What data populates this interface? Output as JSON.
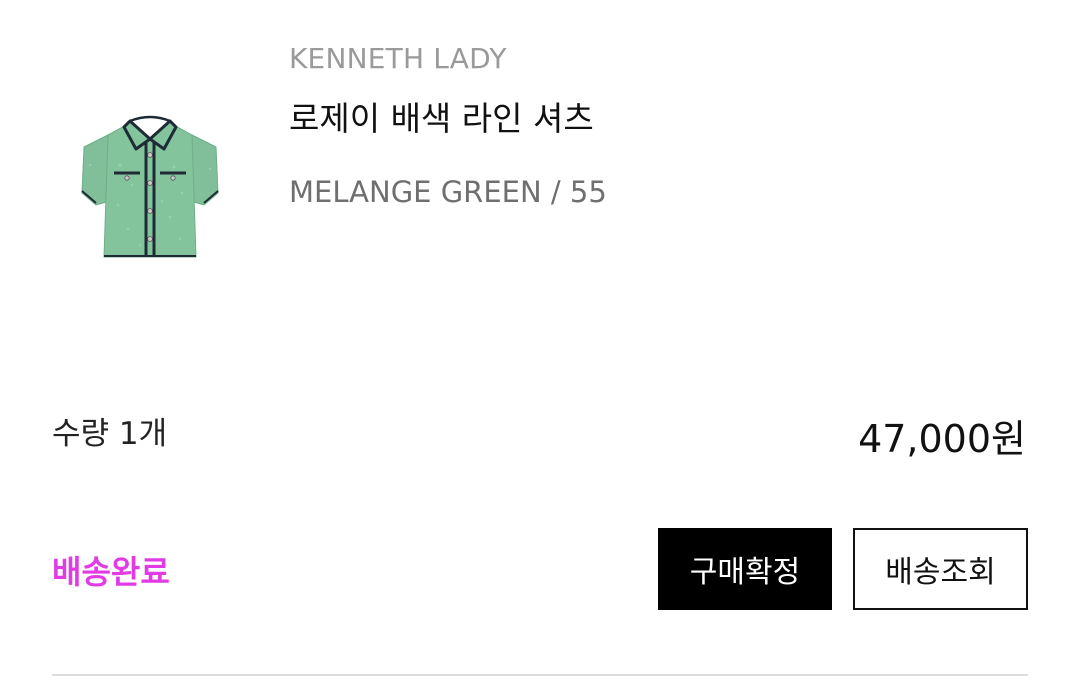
{
  "order_item": {
    "image_icon": "green-tweed-short-sleeve-shirt-image",
    "brand": "KENNETH LADY",
    "name": "로제이 배색 라인 셔츠",
    "option": "MELANGE GREEN / 55",
    "quantity_label": "수량 1개",
    "price": "47,000원",
    "status": "배송완료",
    "buttons": {
      "confirm_purchase": "구매확정",
      "track_delivery": "배송조회"
    }
  },
  "colors": {
    "status": "#e13be6",
    "confirm_button_bg": "#000000",
    "confirm_button_text": "#ffffff",
    "track_button_border": "#111111",
    "divider": "#dcdcdc",
    "shirt_green": "#7fbf98",
    "shirt_trim": "#1e2b35"
  }
}
